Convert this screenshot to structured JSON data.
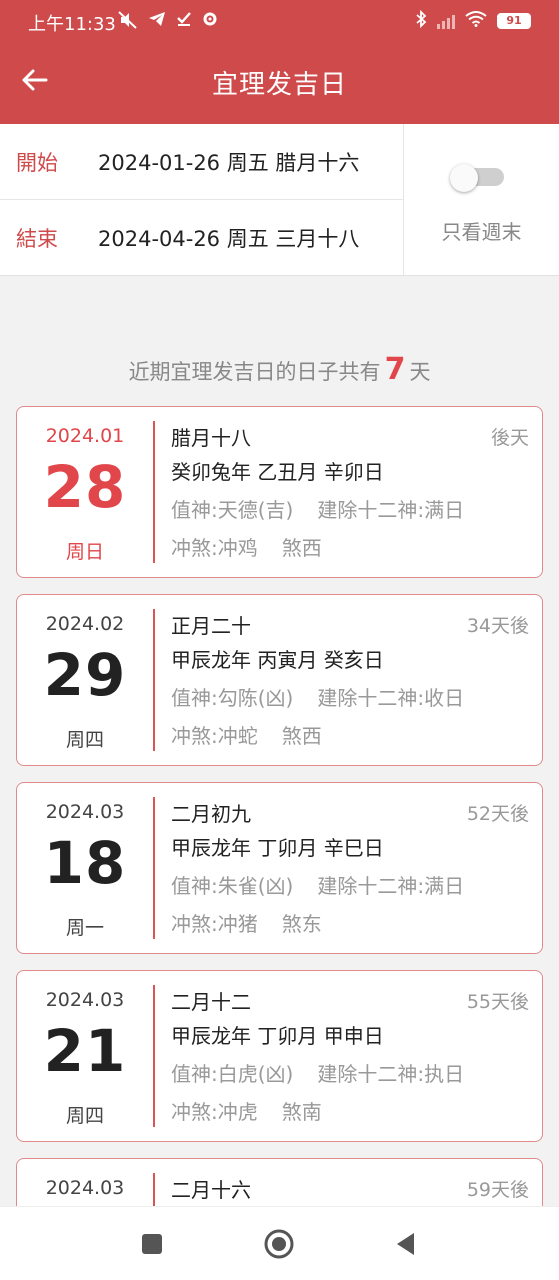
{
  "status": {
    "time": "上午11:33",
    "battery": "91"
  },
  "header": {
    "title": "宜理发吉日"
  },
  "range": {
    "start_label": "開始",
    "start_value": "2024-01-26 周五 腊月十六",
    "end_label": "結束",
    "end_value": "2024-04-26 周五 三月十八",
    "weekend_only_label": "只看週末",
    "weekend_only": false
  },
  "summary": {
    "prefix": "近期宜理发吉日的日子共有",
    "count": "7",
    "suffix": "天"
  },
  "days": [
    {
      "ym": "2024.01",
      "day": "28",
      "weekday": "周日",
      "lunar": "腊月十八",
      "relative": "後天",
      "ganzhi": "癸卯兔年 乙丑月 辛卯日",
      "zhishen": "值神:天德(吉)",
      "jianchu": "建除十二神:满日",
      "chong": "冲煞:冲鸡",
      "sha": "煞西",
      "highlight": true
    },
    {
      "ym": "2024.02",
      "day": "29",
      "weekday": "周四",
      "lunar": "正月二十",
      "relative": "34天後",
      "ganzhi": "甲辰龙年 丙寅月 癸亥日",
      "zhishen": "值神:勾陈(凶)",
      "jianchu": "建除十二神:收日",
      "chong": "冲煞:冲蛇",
      "sha": "煞西",
      "highlight": false
    },
    {
      "ym": "2024.03",
      "day": "18",
      "weekday": "周一",
      "lunar": "二月初九",
      "relative": "52天後",
      "ganzhi": "甲辰龙年 丁卯月 辛巳日",
      "zhishen": "值神:朱雀(凶)",
      "jianchu": "建除十二神:满日",
      "chong": "冲煞:冲猪",
      "sha": "煞东",
      "highlight": false
    },
    {
      "ym": "2024.03",
      "day": "21",
      "weekday": "周四",
      "lunar": "二月十二",
      "relative": "55天後",
      "ganzhi": "甲辰龙年 丁卯月 甲申日",
      "zhishen": "值神:白虎(凶)",
      "jianchu": "建除十二神:执日",
      "chong": "冲煞:冲虎",
      "sha": "煞南",
      "highlight": false
    },
    {
      "ym": "2024.03",
      "day": "",
      "weekday": "",
      "lunar": "二月十六",
      "relative": "59天後",
      "ganzhi": "",
      "zhishen": "",
      "jianchu": "",
      "chong": "",
      "sha": "",
      "highlight": false
    }
  ],
  "colors": {
    "brand_red": "#cf4a4a",
    "highlight_red": "#e0464a",
    "muted_gray": "#999999"
  }
}
